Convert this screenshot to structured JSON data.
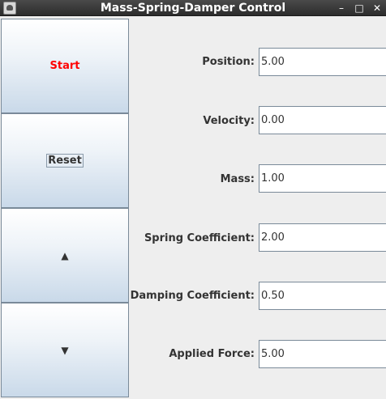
{
  "window": {
    "title": "Mass-Spring-Damper Control",
    "minimize_glyph": "–",
    "maximize_glyph": "□",
    "close_glyph": "✕"
  },
  "controls": {
    "start_label": "Start",
    "reset_label": "Reset",
    "up_glyph": "▲",
    "down_glyph": "▼"
  },
  "fields": [
    {
      "label": "Position:",
      "value": "5.00"
    },
    {
      "label": "Velocity:",
      "value": "0.00"
    },
    {
      "label": "Mass:",
      "value": "1.00"
    },
    {
      "label": "Spring Coefficient:",
      "value": "2.00"
    },
    {
      "label": "Damping Coefficient:",
      "value": "0.50"
    },
    {
      "label": "Applied Force:",
      "value": "5.00"
    }
  ],
  "colors": {
    "start_text": "#ff0000",
    "titlebar": "#333333"
  }
}
